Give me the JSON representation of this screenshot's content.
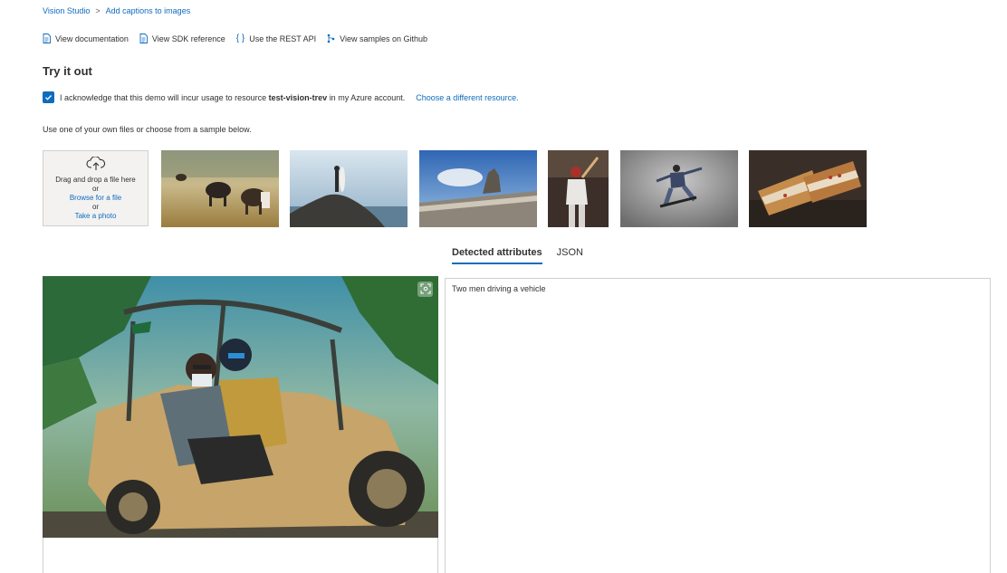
{
  "breadcrumb": {
    "root": "Vision Studio",
    "separator": ">",
    "current": "Add captions to images"
  },
  "top_links": [
    {
      "label": "View documentation",
      "icon": "document-icon"
    },
    {
      "label": "View SDK reference",
      "icon": "document-icon"
    },
    {
      "label": "Use the REST API",
      "icon": "braces-icon"
    },
    {
      "label": "View samples on Github",
      "icon": "branch-icon"
    }
  ],
  "section_title": "Try it out",
  "acknowledgement": {
    "checked": true,
    "text_before": "I acknowledge that this demo will incur usage to resource",
    "resource": "test-vision-trev",
    "text_after": "in my Azure account.",
    "change_link": "Choose a different resource."
  },
  "instructions": "Use one of your own files or choose from a sample below.",
  "dropzone": {
    "icon": "cloud-upload-icon",
    "title": "Drag and drop a file here",
    "or1": "or",
    "browse": "Browse for a file",
    "or2": "or",
    "photo": "Take a photo"
  },
  "samples": [
    {
      "subject": "cows in field"
    },
    {
      "subject": "surfer on rock"
    },
    {
      "subject": "statue on building"
    },
    {
      "subject": "baseball batter"
    },
    {
      "subject": "skateboarder"
    },
    {
      "subject": "sandwich"
    }
  ],
  "tabs": [
    {
      "label": "Detected attributes",
      "active": true
    },
    {
      "label": "JSON",
      "active": false
    }
  ],
  "result": {
    "caption": "Two men driving a vehicle"
  },
  "colors": {
    "accent": "#0f6cbd",
    "text": "#323130",
    "border": "#d2d0ce"
  }
}
